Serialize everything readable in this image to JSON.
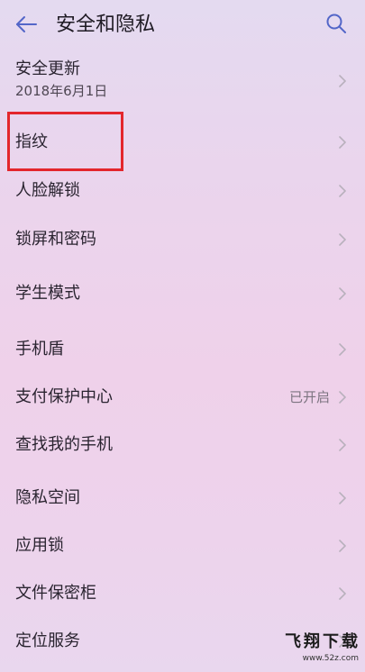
{
  "header": {
    "title": "安全和隐私",
    "back_icon": "arrow-left-icon",
    "search_icon": "search-icon"
  },
  "colors": {
    "accent": "#5366c8",
    "highlight": "#e3262c",
    "text": "#2a2430",
    "chevron": "#b8b0bc"
  },
  "icons": {
    "chevron": "chevron-right-icon"
  },
  "groups": [
    {
      "items": [
        {
          "label": "安全更新",
          "subtitle": "2018年6月1日"
        }
      ]
    },
    {
      "items": [
        {
          "label": "指纹"
        },
        {
          "label": "人脸解锁"
        },
        {
          "label": "锁屏和密码"
        }
      ]
    },
    {
      "items": [
        {
          "label": "学生模式"
        }
      ]
    },
    {
      "items": [
        {
          "label": "手机盾"
        },
        {
          "label": "支付保护中心",
          "value": "已开启"
        },
        {
          "label": "查找我的手机"
        }
      ]
    },
    {
      "items": [
        {
          "label": "隐私空间"
        },
        {
          "label": "应用锁"
        },
        {
          "label": "文件保密柜"
        },
        {
          "label": "定位服务"
        }
      ]
    }
  ],
  "watermark": {
    "brand": "飞翔下载",
    "url": "www.52z.com"
  }
}
